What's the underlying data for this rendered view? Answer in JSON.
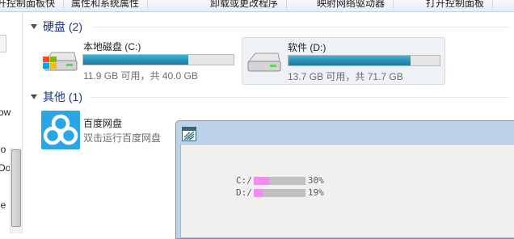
{
  "toolbar": {
    "items": [
      "打开控制面板快",
      "属性和系统属性",
      "卸载或更改程序",
      "映射网络驱动器",
      "打开控制面板"
    ]
  },
  "nav": {
    "fragments": [
      "ow",
      "lo",
      "Do",
      "le"
    ]
  },
  "groups": {
    "disks_label": "硬盘 (2)",
    "other_label": "其他 (1)"
  },
  "drives": [
    {
      "name": "本地磁盘 (C:)",
      "info": "11.9 GB 可用，共 40.0 GB",
      "used_fraction": 0.7
    },
    {
      "name": "软件 (D:)",
      "info": "13.7 GB 可用，共 71.7 GB",
      "used_fraction": 0.81
    }
  ],
  "other_items": [
    {
      "name": "百度网盘",
      "desc": "双击运行百度网盘"
    }
  ],
  "usage_window": {
    "rows": [
      {
        "label": "C:/",
        "percent_text": "30%",
        "fraction": 0.3
      },
      {
        "label": "D:/",
        "percent_text": "19%",
        "fraction": 0.19
      }
    ]
  },
  "colors": {
    "drive_bar": "#2a8fb3",
    "usage_bar": "#f28cf2",
    "group_header": "#1e3287"
  }
}
